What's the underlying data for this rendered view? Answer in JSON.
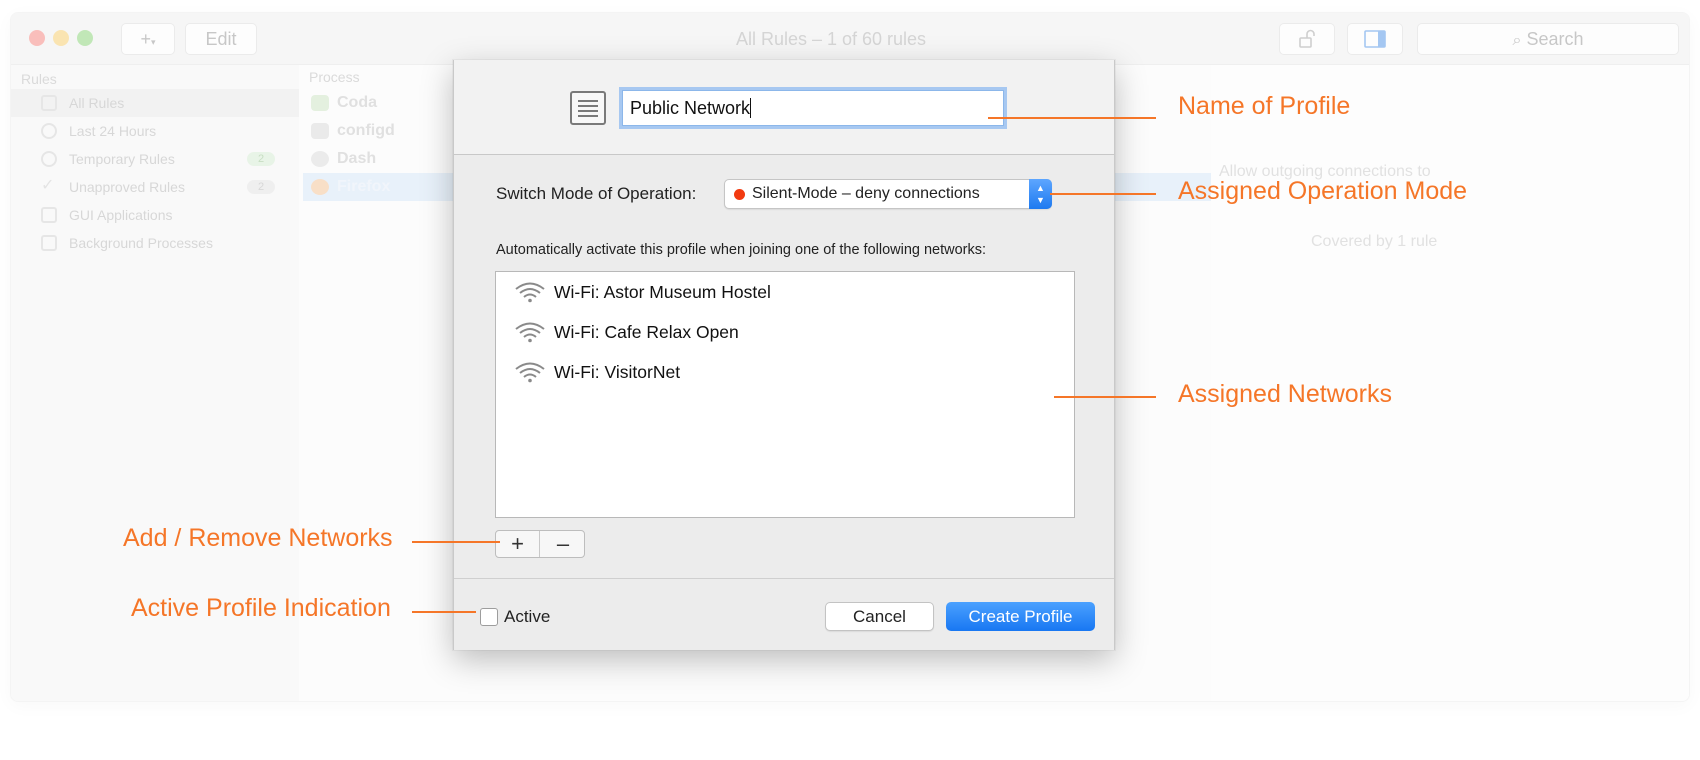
{
  "window": {
    "title": "All Rules  –  1 of 60 rules",
    "toolbar": {
      "add_label": "+",
      "edit_label": "Edit",
      "search_placeholder": "Search"
    }
  },
  "sidebar": {
    "section_title": "Rules",
    "items": [
      {
        "label": "All Rules"
      },
      {
        "label": "Last 24 Hours"
      },
      {
        "label": "Temporary Rules",
        "badge": "2"
      },
      {
        "label": "Unapproved Rules",
        "badge": "2"
      },
      {
        "label": "GUI Applications"
      },
      {
        "label": "Background Processes"
      }
    ]
  },
  "process_list": {
    "column_header": "Process",
    "rows": [
      {
        "name": "Coda"
      },
      {
        "name": "configd"
      },
      {
        "name": "Dash"
      },
      {
        "name": "Firefox"
      }
    ]
  },
  "details": {
    "text": "Allow outgoing connections to",
    "covered": "Covered by 1 rule"
  },
  "dialog": {
    "profile_name": "Public Network",
    "mode_label": "Switch Mode of Operation:",
    "mode_value": "Silent-Mode – deny connections",
    "mode_color": "#f23a10",
    "networks_caption": "Automatically activate this profile when joining one of the following networks:",
    "networks": [
      {
        "label": "Wi-Fi: Astor Museum Hostel",
        "icon": "wifi-icon"
      },
      {
        "label": "Wi-Fi: Cafe Relax Open",
        "icon": "wifi-icon"
      },
      {
        "label": "Wi-Fi: VisitorNet",
        "icon": "wifi-icon"
      }
    ],
    "add_label": "+",
    "remove_label": "–",
    "active_label": "Active",
    "active_checked": false,
    "cancel_label": "Cancel",
    "create_label": "Create Profile"
  },
  "annotations": {
    "name_of_profile": "Name of Profile",
    "operation_mode": "Assigned Operation Mode",
    "networks": "Assigned Networks",
    "add_remove": "Add / Remove Networks",
    "active_indication": "Active Profile Indication",
    "accent_color": "#f57628"
  }
}
